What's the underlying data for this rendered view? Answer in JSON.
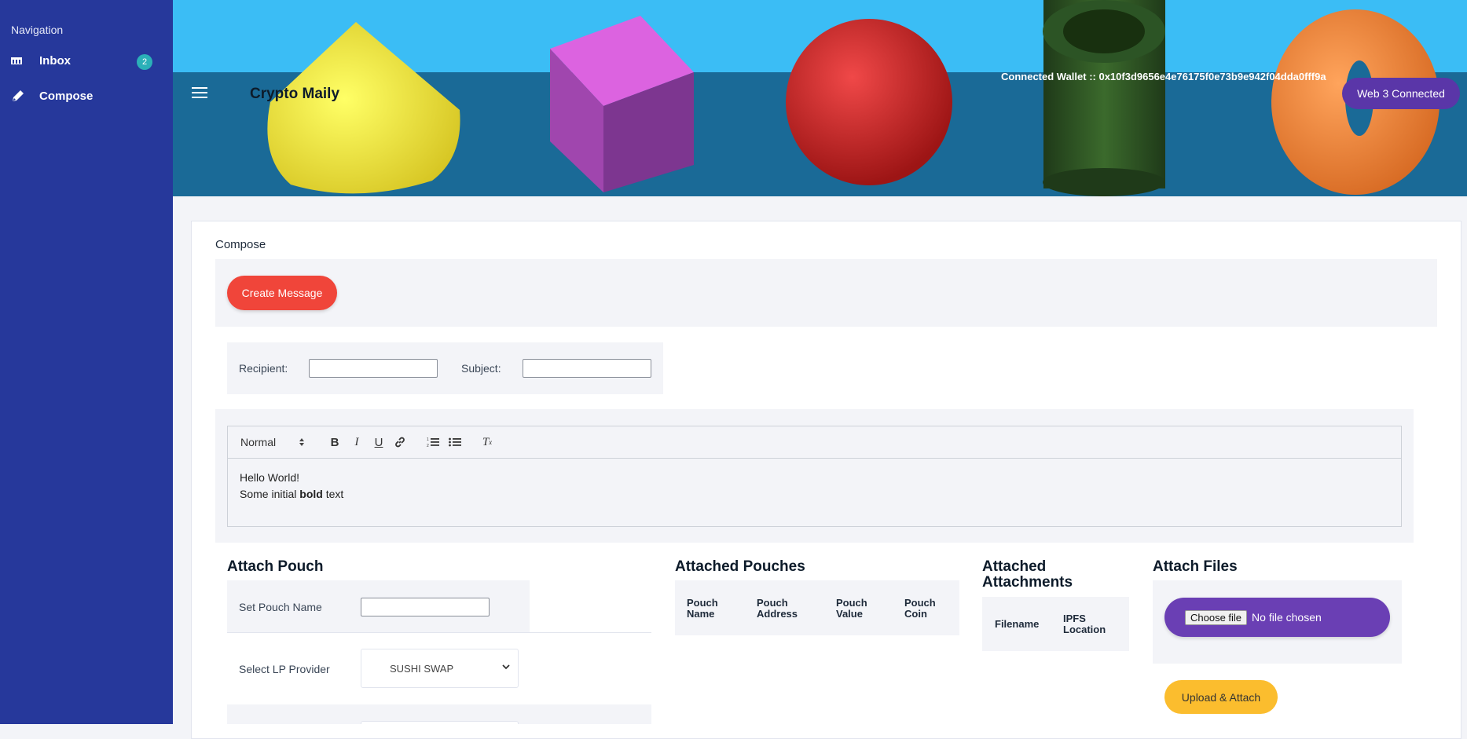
{
  "sidebar": {
    "title": "Navigation",
    "items": [
      {
        "label": "Inbox",
        "icon": "inbox-icon",
        "badge": "2"
      },
      {
        "label": "Compose",
        "icon": "pencil-icon"
      }
    ]
  },
  "header": {
    "app_title": "Crypto Maily",
    "wallet": "Connected Wallet :: 0x10f3d9656e4e76175f0e73b9e942f04dda0fff9a",
    "web3_button": "Web 3 Connected"
  },
  "compose": {
    "label": "Compose",
    "create_button": "Create Message",
    "recipient_label": "Recipient:",
    "recipient_value": "",
    "subject_label": "Subject:",
    "subject_value": ""
  },
  "editor": {
    "format_select": "Normal",
    "line1": "Hello World!",
    "line2_prefix": "Some initial ",
    "line2_bold": "bold",
    "line2_suffix": " text"
  },
  "attach_pouch": {
    "title": "Attach Pouch",
    "name_label": "Set Pouch Name",
    "name_value": "",
    "lp_label": "Select LP Provider",
    "lp_selected": "SUSHI SWAP"
  },
  "attached_pouches": {
    "title": "Attached Pouches",
    "columns": [
      "Pouch\nName",
      "Pouch\nAddress",
      "Pouch\nValue",
      "Pouch\nCoin"
    ]
  },
  "attached_attachments": {
    "title": "Attached Attachments",
    "columns": [
      "Filename",
      "IPFS\nLocation"
    ]
  },
  "attach_files": {
    "title": "Attach Files",
    "choose_label": "Choose file",
    "no_file": "No file chosen",
    "upload_button": "Upload & Attach"
  },
  "colors": {
    "sidebar": "#26389b",
    "create": "#f0453a",
    "web3": "#5a36a8",
    "file": "#6a3fb4",
    "upload": "#fbbd2e"
  }
}
